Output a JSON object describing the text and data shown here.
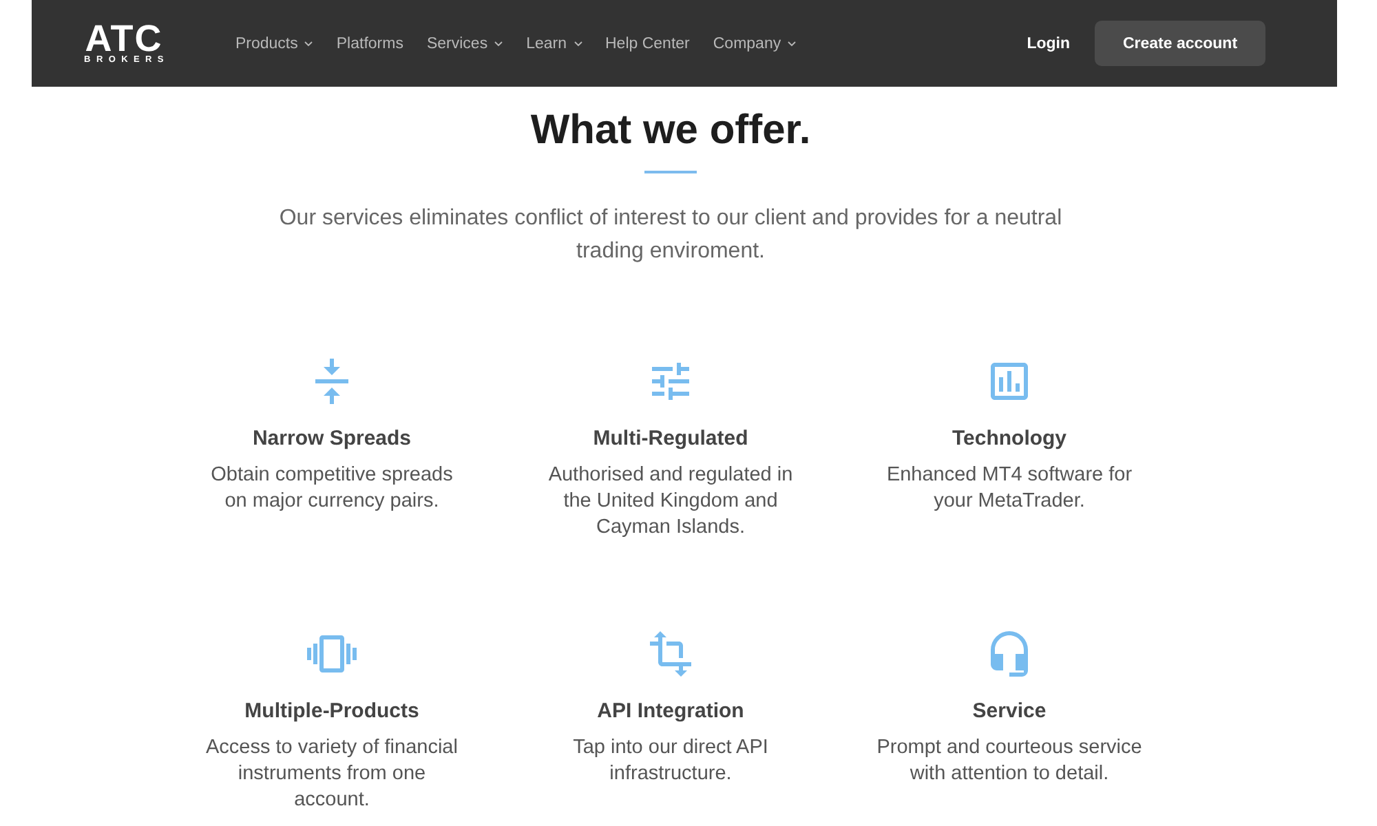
{
  "header": {
    "logo": {
      "name": "ATC",
      "subtitle": "BROKERS"
    },
    "nav": [
      {
        "label": "Products",
        "dropdown": true
      },
      {
        "label": "Platforms",
        "dropdown": false
      },
      {
        "label": "Services",
        "dropdown": true
      },
      {
        "label": "Learn",
        "dropdown": true
      },
      {
        "label": "Help Center",
        "dropdown": false
      },
      {
        "label": "Company",
        "dropdown": true
      }
    ],
    "login": "Login",
    "create_account": "Create account"
  },
  "offer": {
    "title": "What we offer.",
    "intro": "Our services eliminates conflict of interest to our client and provides for a neutral trading enviroment.",
    "features": [
      {
        "title": "Narrow Spreads",
        "description": "Obtain competitive spreads on major currency pairs."
      },
      {
        "title": "Multi-Regulated",
        "description": "Authorised and regulated in the United Kingdom and Cayman Islands."
      },
      {
        "title": "Technology",
        "description": "Enhanced MT4 software for your MetaTrader."
      },
      {
        "title": "Multiple-Products",
        "description": "Access to variety of financial instruments from one account."
      },
      {
        "title": "API Integration",
        "description": "Tap into our direct API infrastructure."
      },
      {
        "title": "Service",
        "description": "Prompt and courteous service with attention to detail."
      }
    ]
  }
}
